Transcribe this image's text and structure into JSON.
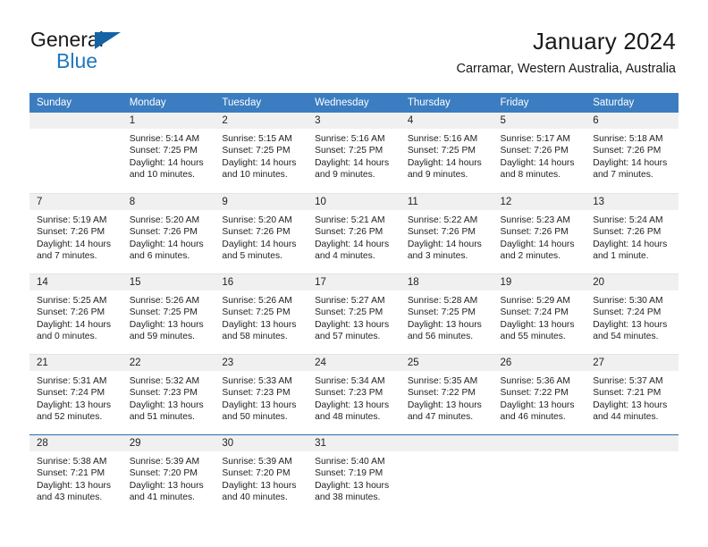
{
  "brand": {
    "name_part1": "General",
    "name_part2": "Blue",
    "logo_icon": "triangle-flag-icon"
  },
  "header": {
    "title": "January 2024",
    "location": "Carramar, Western Australia, Australia"
  },
  "calendar": {
    "weekday_headers": [
      "Sunday",
      "Monday",
      "Tuesday",
      "Wednesday",
      "Thursday",
      "Friday",
      "Saturday"
    ],
    "colors": {
      "header_blue": "#3b7dc0",
      "daynum_band": "#f0f0f0",
      "brand_blue": "#1d78c1",
      "rule_blue": "#2a6db5"
    },
    "weeks": [
      [
        {
          "day": "",
          "sunrise": "",
          "sunset": "",
          "daylight1": "",
          "daylight2": "",
          "empty": true
        },
        {
          "day": "1",
          "sunrise": "Sunrise: 5:14 AM",
          "sunset": "Sunset: 7:25 PM",
          "daylight1": "Daylight: 14 hours",
          "daylight2": "and 10 minutes."
        },
        {
          "day": "2",
          "sunrise": "Sunrise: 5:15 AM",
          "sunset": "Sunset: 7:25 PM",
          "daylight1": "Daylight: 14 hours",
          "daylight2": "and 10 minutes."
        },
        {
          "day": "3",
          "sunrise": "Sunrise: 5:16 AM",
          "sunset": "Sunset: 7:25 PM",
          "daylight1": "Daylight: 14 hours",
          "daylight2": "and 9 minutes."
        },
        {
          "day": "4",
          "sunrise": "Sunrise: 5:16 AM",
          "sunset": "Sunset: 7:25 PM",
          "daylight1": "Daylight: 14 hours",
          "daylight2": "and 9 minutes."
        },
        {
          "day": "5",
          "sunrise": "Sunrise: 5:17 AM",
          "sunset": "Sunset: 7:26 PM",
          "daylight1": "Daylight: 14 hours",
          "daylight2": "and 8 minutes."
        },
        {
          "day": "6",
          "sunrise": "Sunrise: 5:18 AM",
          "sunset": "Sunset: 7:26 PM",
          "daylight1": "Daylight: 14 hours",
          "daylight2": "and 7 minutes."
        }
      ],
      [
        {
          "day": "7",
          "sunrise": "Sunrise: 5:19 AM",
          "sunset": "Sunset: 7:26 PM",
          "daylight1": "Daylight: 14 hours",
          "daylight2": "and 7 minutes."
        },
        {
          "day": "8",
          "sunrise": "Sunrise: 5:20 AM",
          "sunset": "Sunset: 7:26 PM",
          "daylight1": "Daylight: 14 hours",
          "daylight2": "and 6 minutes."
        },
        {
          "day": "9",
          "sunrise": "Sunrise: 5:20 AM",
          "sunset": "Sunset: 7:26 PM",
          "daylight1": "Daylight: 14 hours",
          "daylight2": "and 5 minutes."
        },
        {
          "day": "10",
          "sunrise": "Sunrise: 5:21 AM",
          "sunset": "Sunset: 7:26 PM",
          "daylight1": "Daylight: 14 hours",
          "daylight2": "and 4 minutes."
        },
        {
          "day": "11",
          "sunrise": "Sunrise: 5:22 AM",
          "sunset": "Sunset: 7:26 PM",
          "daylight1": "Daylight: 14 hours",
          "daylight2": "and 3 minutes."
        },
        {
          "day": "12",
          "sunrise": "Sunrise: 5:23 AM",
          "sunset": "Sunset: 7:26 PM",
          "daylight1": "Daylight: 14 hours",
          "daylight2": "and 2 minutes."
        },
        {
          "day": "13",
          "sunrise": "Sunrise: 5:24 AM",
          "sunset": "Sunset: 7:26 PM",
          "daylight1": "Daylight: 14 hours",
          "daylight2": "and 1 minute."
        }
      ],
      [
        {
          "day": "14",
          "sunrise": "Sunrise: 5:25 AM",
          "sunset": "Sunset: 7:26 PM",
          "daylight1": "Daylight: 14 hours",
          "daylight2": "and 0 minutes."
        },
        {
          "day": "15",
          "sunrise": "Sunrise: 5:26 AM",
          "sunset": "Sunset: 7:25 PM",
          "daylight1": "Daylight: 13 hours",
          "daylight2": "and 59 minutes."
        },
        {
          "day": "16",
          "sunrise": "Sunrise: 5:26 AM",
          "sunset": "Sunset: 7:25 PM",
          "daylight1": "Daylight: 13 hours",
          "daylight2": "and 58 minutes."
        },
        {
          "day": "17",
          "sunrise": "Sunrise: 5:27 AM",
          "sunset": "Sunset: 7:25 PM",
          "daylight1": "Daylight: 13 hours",
          "daylight2": "and 57 minutes."
        },
        {
          "day": "18",
          "sunrise": "Sunrise: 5:28 AM",
          "sunset": "Sunset: 7:25 PM",
          "daylight1": "Daylight: 13 hours",
          "daylight2": "and 56 minutes."
        },
        {
          "day": "19",
          "sunrise": "Sunrise: 5:29 AM",
          "sunset": "Sunset: 7:24 PM",
          "daylight1": "Daylight: 13 hours",
          "daylight2": "and 55 minutes."
        },
        {
          "day": "20",
          "sunrise": "Sunrise: 5:30 AM",
          "sunset": "Sunset: 7:24 PM",
          "daylight1": "Daylight: 13 hours",
          "daylight2": "and 54 minutes."
        }
      ],
      [
        {
          "day": "21",
          "sunrise": "Sunrise: 5:31 AM",
          "sunset": "Sunset: 7:24 PM",
          "daylight1": "Daylight: 13 hours",
          "daylight2": "and 52 minutes."
        },
        {
          "day": "22",
          "sunrise": "Sunrise: 5:32 AM",
          "sunset": "Sunset: 7:23 PM",
          "daylight1": "Daylight: 13 hours",
          "daylight2": "and 51 minutes."
        },
        {
          "day": "23",
          "sunrise": "Sunrise: 5:33 AM",
          "sunset": "Sunset: 7:23 PM",
          "daylight1": "Daylight: 13 hours",
          "daylight2": "and 50 minutes."
        },
        {
          "day": "24",
          "sunrise": "Sunrise: 5:34 AM",
          "sunset": "Sunset: 7:23 PM",
          "daylight1": "Daylight: 13 hours",
          "daylight2": "and 48 minutes."
        },
        {
          "day": "25",
          "sunrise": "Sunrise: 5:35 AM",
          "sunset": "Sunset: 7:22 PM",
          "daylight1": "Daylight: 13 hours",
          "daylight2": "and 47 minutes."
        },
        {
          "day": "26",
          "sunrise": "Sunrise: 5:36 AM",
          "sunset": "Sunset: 7:22 PM",
          "daylight1": "Daylight: 13 hours",
          "daylight2": "and 46 minutes."
        },
        {
          "day": "27",
          "sunrise": "Sunrise: 5:37 AM",
          "sunset": "Sunset: 7:21 PM",
          "daylight1": "Daylight: 13 hours",
          "daylight2": "and 44 minutes."
        }
      ],
      [
        {
          "day": "28",
          "sunrise": "Sunrise: 5:38 AM",
          "sunset": "Sunset: 7:21 PM",
          "daylight1": "Daylight: 13 hours",
          "daylight2": "and 43 minutes."
        },
        {
          "day": "29",
          "sunrise": "Sunrise: 5:39 AM",
          "sunset": "Sunset: 7:20 PM",
          "daylight1": "Daylight: 13 hours",
          "daylight2": "and 41 minutes."
        },
        {
          "day": "30",
          "sunrise": "Sunrise: 5:39 AM",
          "sunset": "Sunset: 7:20 PM",
          "daylight1": "Daylight: 13 hours",
          "daylight2": "and 40 minutes."
        },
        {
          "day": "31",
          "sunrise": "Sunrise: 5:40 AM",
          "sunset": "Sunset: 7:19 PM",
          "daylight1": "Daylight: 13 hours",
          "daylight2": "and 38 minutes."
        },
        {
          "day": "",
          "sunrise": "",
          "sunset": "",
          "daylight1": "",
          "daylight2": "",
          "empty": true
        },
        {
          "day": "",
          "sunrise": "",
          "sunset": "",
          "daylight1": "",
          "daylight2": "",
          "empty": true
        },
        {
          "day": "",
          "sunrise": "",
          "sunset": "",
          "daylight1": "",
          "daylight2": "",
          "empty": true
        }
      ]
    ]
  }
}
